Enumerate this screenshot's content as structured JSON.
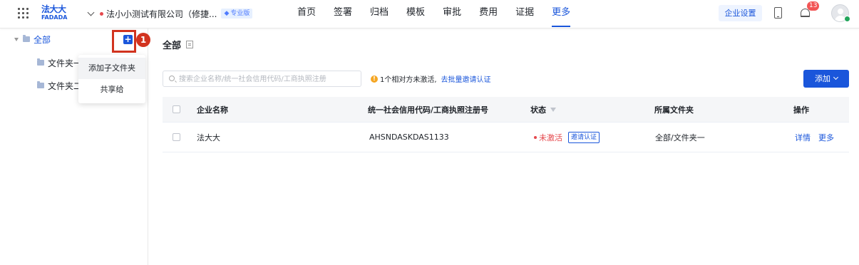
{
  "header": {
    "logo_cn": "法大大",
    "logo_en": "FADADA",
    "company_name": "法小小测试有限公司（修捷...",
    "plan_badge": "专业版",
    "nav": [
      "首页",
      "签署",
      "归档",
      "模板",
      "审批",
      "费用",
      "证据",
      "更多"
    ],
    "active_nav": "更多",
    "settings_label": "企业设置",
    "notification_count": "13"
  },
  "sidebar": {
    "root_label": "全部",
    "folders": [
      "文件夹一",
      "文件夹二"
    ],
    "add_button_symbol": "+",
    "step_number": "1",
    "menu": [
      "添加子文件夹",
      "共享给"
    ]
  },
  "main": {
    "title": "全部",
    "search_placeholder": "搜索企业名称/统一社会信用代码/工商执照注册",
    "notice_text": "1个相对方未激活,",
    "notice_link": "去批量邀请认证",
    "add_label": "添加",
    "columns": [
      "企业名称",
      "统一社会信用代码/工商执照注册号",
      "状态",
      "所属文件夹",
      "操作"
    ],
    "rows": [
      {
        "name": "法大大",
        "code": "AHSNDASKDAS1133",
        "status": "未激活",
        "status_action": "邀请认证",
        "folder": "全部/文件夹一",
        "actions": [
          "详情",
          "更多"
        ]
      }
    ]
  },
  "colors": {
    "primary": "#1a56db",
    "danger": "#e5484d",
    "annotation": "#d2331f"
  }
}
